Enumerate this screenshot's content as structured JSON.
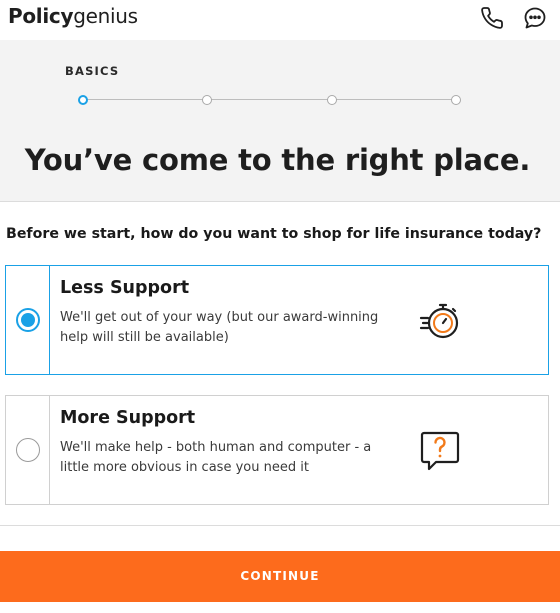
{
  "header": {
    "logo_bold": "Policy",
    "logo_light": "genius",
    "phone_icon": "phone-icon",
    "chat_icon": "chat-icon"
  },
  "progress": {
    "step_label": "BASICS",
    "current_step": 1,
    "total_steps": 4
  },
  "headline": "You’ve come to the right place.",
  "question": "Before we start, how do you want to shop for life insurance today?",
  "options": [
    {
      "title": "Less Support",
      "description": "We'll get out of your way (but our award-winning help will still be available)",
      "selected": true,
      "icon": "stopwatch-icon"
    },
    {
      "title": "More Support",
      "description": "We'll make help - both human and computer - a little more obvious in case you need it",
      "selected": false,
      "icon": "question-bubble-icon"
    }
  ],
  "continue_label": "CONTINUE",
  "colors": {
    "accent_blue": "#1aa1e6",
    "cta_orange": "#fd6b1c",
    "icon_orange": "#f27a1a",
    "hero_gray": "#f3f3f3"
  }
}
